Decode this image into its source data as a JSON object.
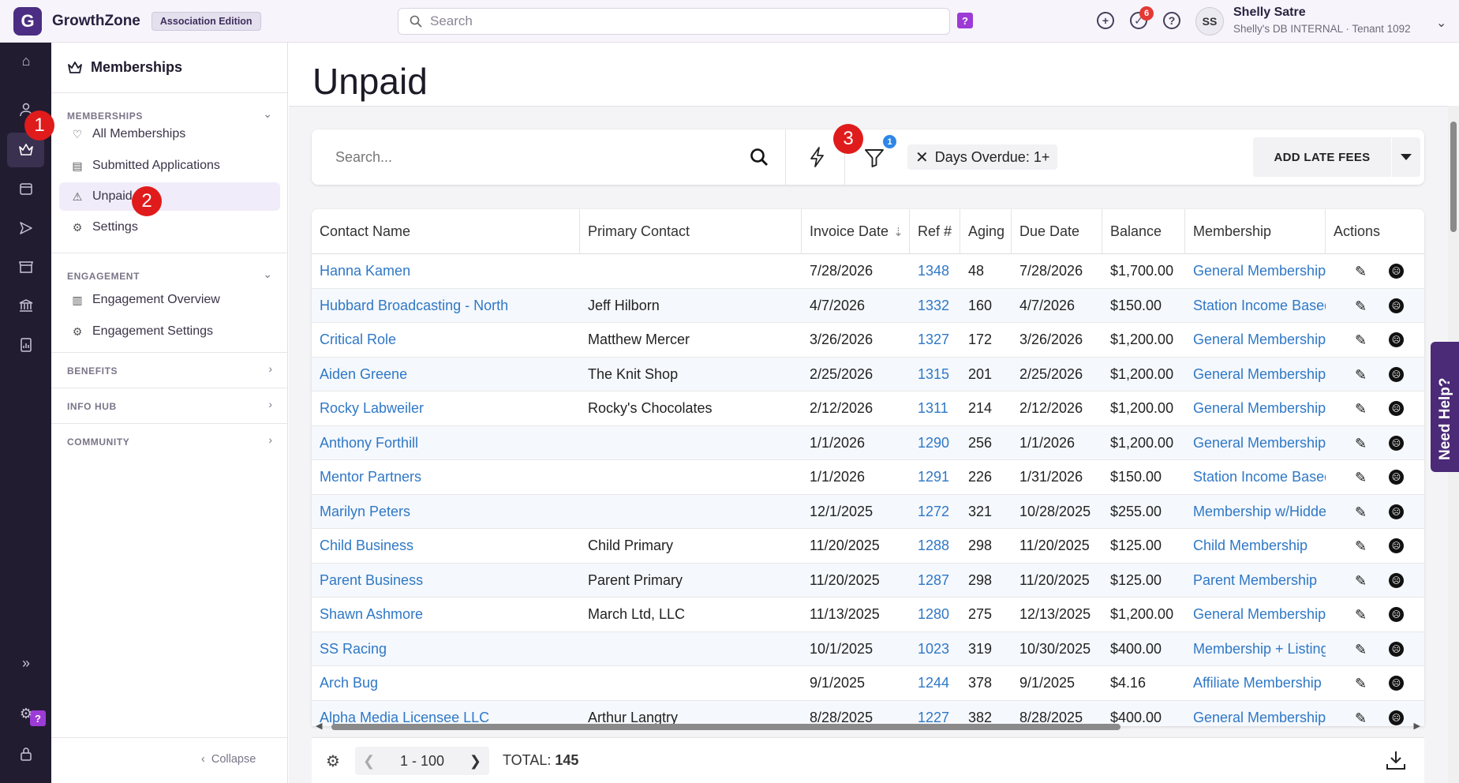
{
  "app": {
    "logo_letter": "G",
    "brand": "GrowthZone",
    "edition": "Association Edition"
  },
  "topbar": {
    "search_placeholder": "Search",
    "help_badge": "?",
    "notification_count": "6",
    "avatar_initials": "SS",
    "user_name": "Shelly Satre",
    "user_tenant": "Shelly's DB INTERNAL · Tenant 1092"
  },
  "sidenav": {
    "title": "Memberships",
    "sections": {
      "memberships": "MEMBERSHIPS",
      "engagement": "ENGAGEMENT",
      "benefits": "BENEFITS",
      "info_hub": "INFO HUB",
      "community": "COMMUNITY"
    },
    "items": {
      "all_memberships": "All Memberships",
      "submitted_applications": "Submitted Applications",
      "unpaid": "Unpaid",
      "settings": "Settings",
      "engagement_overview": "Engagement Overview",
      "engagement_settings": "Engagement Settings"
    },
    "collapse": "Collapse"
  },
  "page": {
    "title": "Unpaid"
  },
  "toolbar": {
    "search_placeholder": "Search...",
    "filter_count": "1",
    "filter_chip": "Days Overdue: 1+",
    "add_late_fees": "ADD LATE FEES"
  },
  "table": {
    "columns": [
      "Contact Name",
      "Primary Contact",
      "Invoice Date",
      "Ref #",
      "Aging",
      "Due Date",
      "Balance",
      "Membership",
      "Actions"
    ],
    "rows": [
      [
        "Hanna Kamen",
        "",
        "7/28/2026",
        "1348",
        "48",
        "7/28/2026",
        "$1,700.00",
        "General Membership"
      ],
      [
        "Hubbard Broadcasting - North",
        "Jeff Hilborn",
        "4/7/2026",
        "1332",
        "160",
        "4/7/2026",
        "$150.00",
        "Station Income Based"
      ],
      [
        "Critical Role",
        "Matthew Mercer",
        "3/26/2026",
        "1327",
        "172",
        "3/26/2026",
        "$1,200.00",
        "General Membership"
      ],
      [
        "Aiden Greene",
        "The Knit Shop",
        "2/25/2026",
        "1315",
        "201",
        "2/25/2026",
        "$1,200.00",
        "General Membership"
      ],
      [
        "Rocky Labweiler",
        "Rocky's Chocolates",
        "2/12/2026",
        "1311",
        "214",
        "2/12/2026",
        "$1,200.00",
        "General Membership"
      ],
      [
        "Anthony Forthill",
        "",
        "1/1/2026",
        "1290",
        "256",
        "1/1/2026",
        "$1,200.00",
        "General Membership"
      ],
      [
        "Mentor Partners",
        "",
        "1/1/2026",
        "1291",
        "226",
        "1/31/2026",
        "$150.00",
        "Station Income Based"
      ],
      [
        "Marilyn Peters",
        "",
        "12/1/2025",
        "1272",
        "321",
        "10/28/2025",
        "$255.00",
        "Membership w/Hidden"
      ],
      [
        "Child Business",
        "Child Primary",
        "11/20/2025",
        "1288",
        "298",
        "11/20/2025",
        "$125.00",
        "Child Membership"
      ],
      [
        "Parent Business",
        "Parent Primary",
        "11/20/2025",
        "1287",
        "298",
        "11/20/2025",
        "$125.00",
        "Parent Membership"
      ],
      [
        "Shawn Ashmore",
        "March Ltd, LLC",
        "11/13/2025",
        "1280",
        "275",
        "12/13/2025",
        "$1,200.00",
        "General Membership"
      ],
      [
        "SS Racing",
        "",
        "10/1/2025",
        "1023",
        "319",
        "10/30/2025",
        "$400.00",
        "Membership + Listing"
      ],
      [
        "Arch Bug",
        "",
        "9/1/2025",
        "1244",
        "378",
        "9/1/2025",
        "$4.16",
        "Affiliate Membership"
      ],
      [
        "Alpha Media Licensee LLC",
        "Arthur Langtry",
        "8/28/2025",
        "1227",
        "382",
        "8/28/2025",
        "$400.00",
        "General Membership"
      ]
    ]
  },
  "footer": {
    "range": "1 - 100",
    "total_label": "TOTAL:",
    "total_value": "145"
  },
  "need_help": "Need Help?",
  "steps": [
    "1",
    "2",
    "3"
  ],
  "colors": {
    "brand": "#4b2e83",
    "link": "#2f78c6",
    "step": "#e01b1b",
    "rail": "#221c30"
  }
}
